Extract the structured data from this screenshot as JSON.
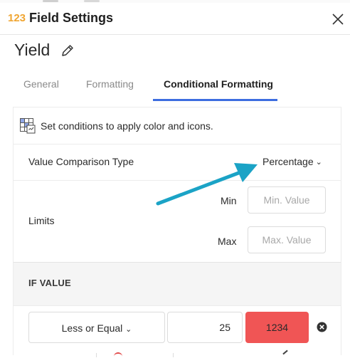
{
  "dialog": {
    "field_type_badge": "123",
    "title": "Field Settings",
    "field_name": "Yield"
  },
  "tabs": [
    {
      "label": "General",
      "active": false
    },
    {
      "label": "Formatting",
      "active": false
    },
    {
      "label": "Conditional Formatting",
      "active": true
    }
  ],
  "hint": {
    "text": "Set conditions to apply color and icons."
  },
  "comparison": {
    "label": "Value Comparison Type",
    "selected": "Percentage"
  },
  "limits": {
    "label": "Limits",
    "min_label": "Min",
    "min_placeholder": "Min. Value",
    "max_label": "Max",
    "max_placeholder": "Max. Value"
  },
  "if_value": {
    "label": "IF VALUE"
  },
  "condition": {
    "operator": "Less or Equal",
    "value": "25",
    "format_preview": "1234"
  },
  "colors": {
    "accent": "#3d6de0",
    "badge": "#f0a531",
    "format_fill": "#f05555",
    "annotation_arrow": "#1ba3c6"
  }
}
